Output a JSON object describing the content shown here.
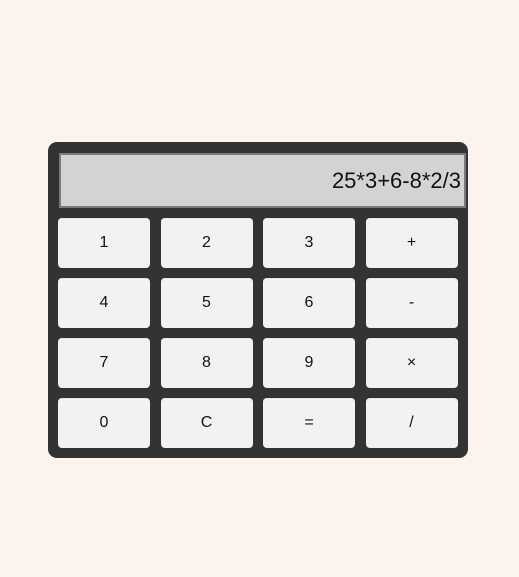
{
  "display": {
    "value": "25*3+6-8*2/3"
  },
  "keys": [
    {
      "label": "1",
      "name": "key-1"
    },
    {
      "label": "2",
      "name": "key-2"
    },
    {
      "label": "3",
      "name": "key-3"
    },
    {
      "label": "+",
      "name": "key-add"
    },
    {
      "label": "4",
      "name": "key-4"
    },
    {
      "label": "5",
      "name": "key-5"
    },
    {
      "label": "6",
      "name": "key-6"
    },
    {
      "label": "-",
      "name": "key-subtract"
    },
    {
      "label": "7",
      "name": "key-7"
    },
    {
      "label": "8",
      "name": "key-8"
    },
    {
      "label": "9",
      "name": "key-9"
    },
    {
      "label": "×",
      "name": "key-multiply"
    },
    {
      "label": "0",
      "name": "key-0"
    },
    {
      "label": "C",
      "name": "key-clear"
    },
    {
      "label": "=",
      "name": "key-equals"
    },
    {
      "label": "/",
      "name": "key-divide"
    }
  ],
  "colors": {
    "page_background": "#fdf3ee",
    "calculator_body": "#333333",
    "display_background": "#d3d3d3",
    "key_background": "#f2f2f2"
  }
}
